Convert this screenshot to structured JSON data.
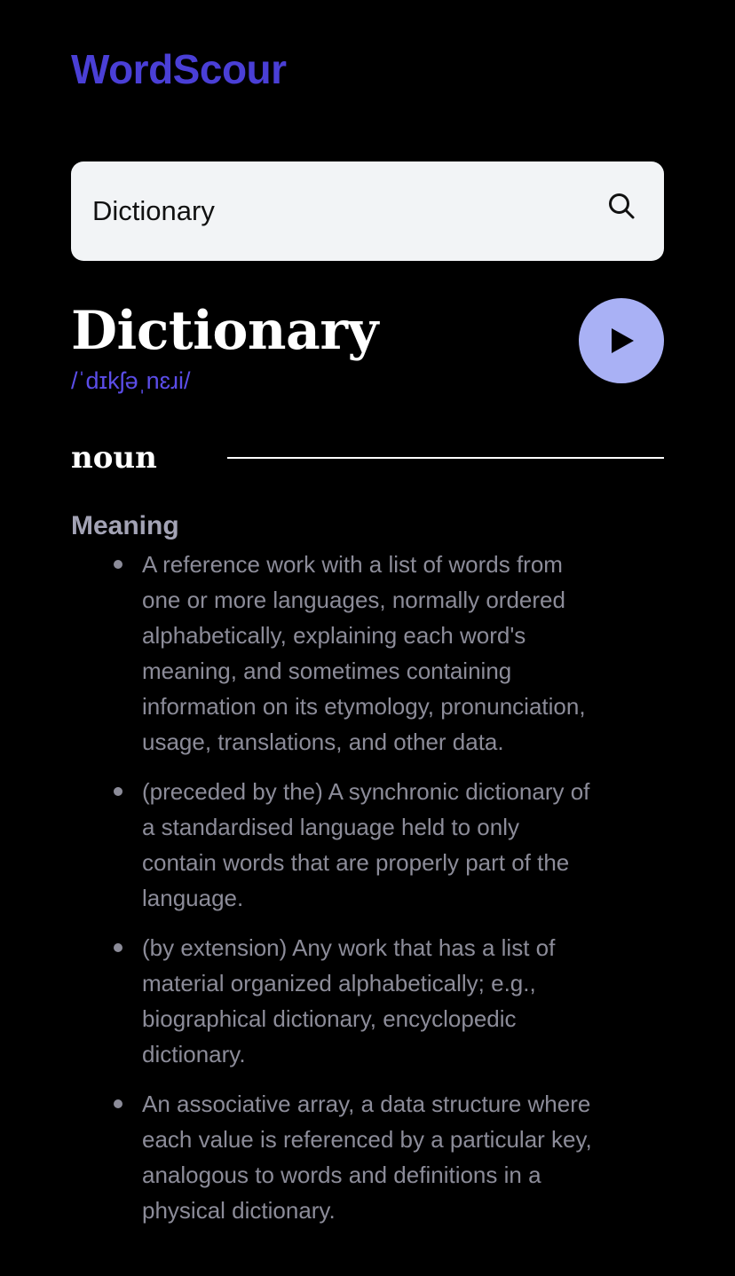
{
  "app": {
    "name": "WordScour"
  },
  "colors": {
    "brand": "#4a3fd6",
    "phonetic": "#5b4de8",
    "search_bg": "#f2f4f6",
    "play_bg": "#a9b1f5",
    "play_icon": "#000000"
  },
  "search": {
    "value": "Dictionary",
    "placeholder": "",
    "icon": "search-icon"
  },
  "entry": {
    "word": "Dictionary",
    "phonetic": "/ˈdɪkʃəˌnɛɹi/",
    "play_icon": "play-icon"
  },
  "meanings": [
    {
      "part_of_speech": "noun",
      "heading": "Meaning",
      "definitions": [
        "A reference work with a list of words from one or more languages, normally ordered alphabetically, explaining each word's meaning, and sometimes containing information on its etymology, pronunciation, usage, translations, and other data.",
        "(preceded by the) A synchronic dictionary of a standardised language held to only contain words that are properly part of the language.",
        "(by extension) Any work that has a list of material organized alphabetically; e.g., biographical dictionary, encyclopedic dictionary.",
        "An associative array, a data structure where each value is referenced by a particular key, analogous to words and definitions in a physical dictionary."
      ]
    }
  ]
}
